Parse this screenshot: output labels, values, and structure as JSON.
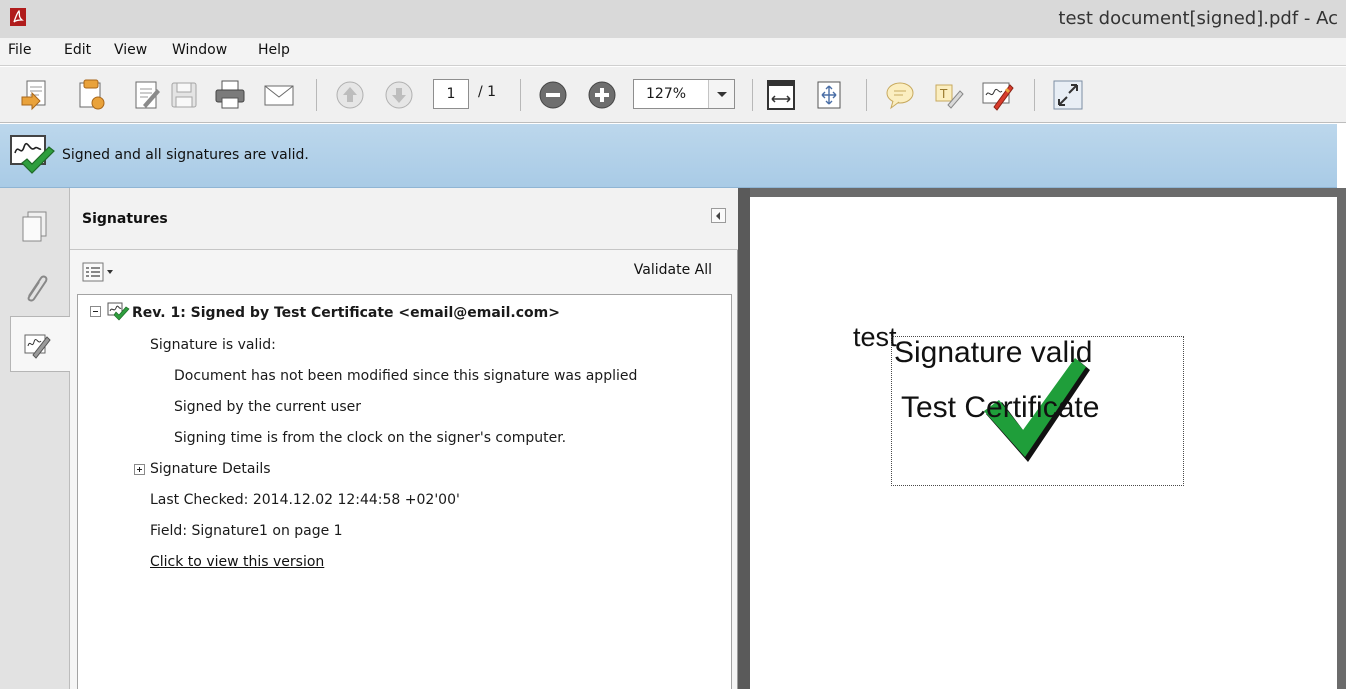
{
  "window": {
    "title": "test document[signed].pdf - Ac"
  },
  "menu": {
    "items": [
      "File",
      "Edit",
      "View",
      "Window",
      "Help"
    ]
  },
  "toolbar": {
    "icons": [
      "create-pdf-icon",
      "open-icon",
      "edit-icon",
      "save-icon",
      "print-icon",
      "email-icon",
      "previous-page-icon",
      "next-page-icon",
      "zoom-out-icon",
      "zoom-in-icon",
      "fit-page-icon",
      "fit-width-icon",
      "comment-icon",
      "highlight-text-icon",
      "sign-icon",
      "full-screen-icon"
    ],
    "current_page": "1",
    "page_total": "/ 1",
    "zoom": "127%"
  },
  "signature_bar": {
    "message": "Signed and all signatures are valid.",
    "colors": {
      "background": "#b4d2ea",
      "check": "#2e9e3e"
    }
  },
  "nav_rail": {
    "items": [
      "page-thumbnails-icon",
      "attachments-icon",
      "signatures-icon"
    ],
    "active": "signatures"
  },
  "signatures_panel": {
    "title": "Signatures",
    "validate_all": "Validate All",
    "tree": {
      "revision": "Rev. 1: Signed by Test Certificate <email@email.com>",
      "status": "Signature is valid:",
      "details": [
        "Document has not been modified since this signature was applied",
        "Signed by the current user",
        "Signing time is from the clock on the signer's computer."
      ],
      "signature_details": "Signature Details",
      "last_checked": "Last Checked: 2014.12.02 12:44:58 +02'00'",
      "field": "Field: Signature1 on page 1",
      "view_version": "Click to view this version"
    }
  },
  "document": {
    "text": "test",
    "signature_appearance": {
      "line1": "Signature valid",
      "line2": "Test Certificate"
    }
  }
}
